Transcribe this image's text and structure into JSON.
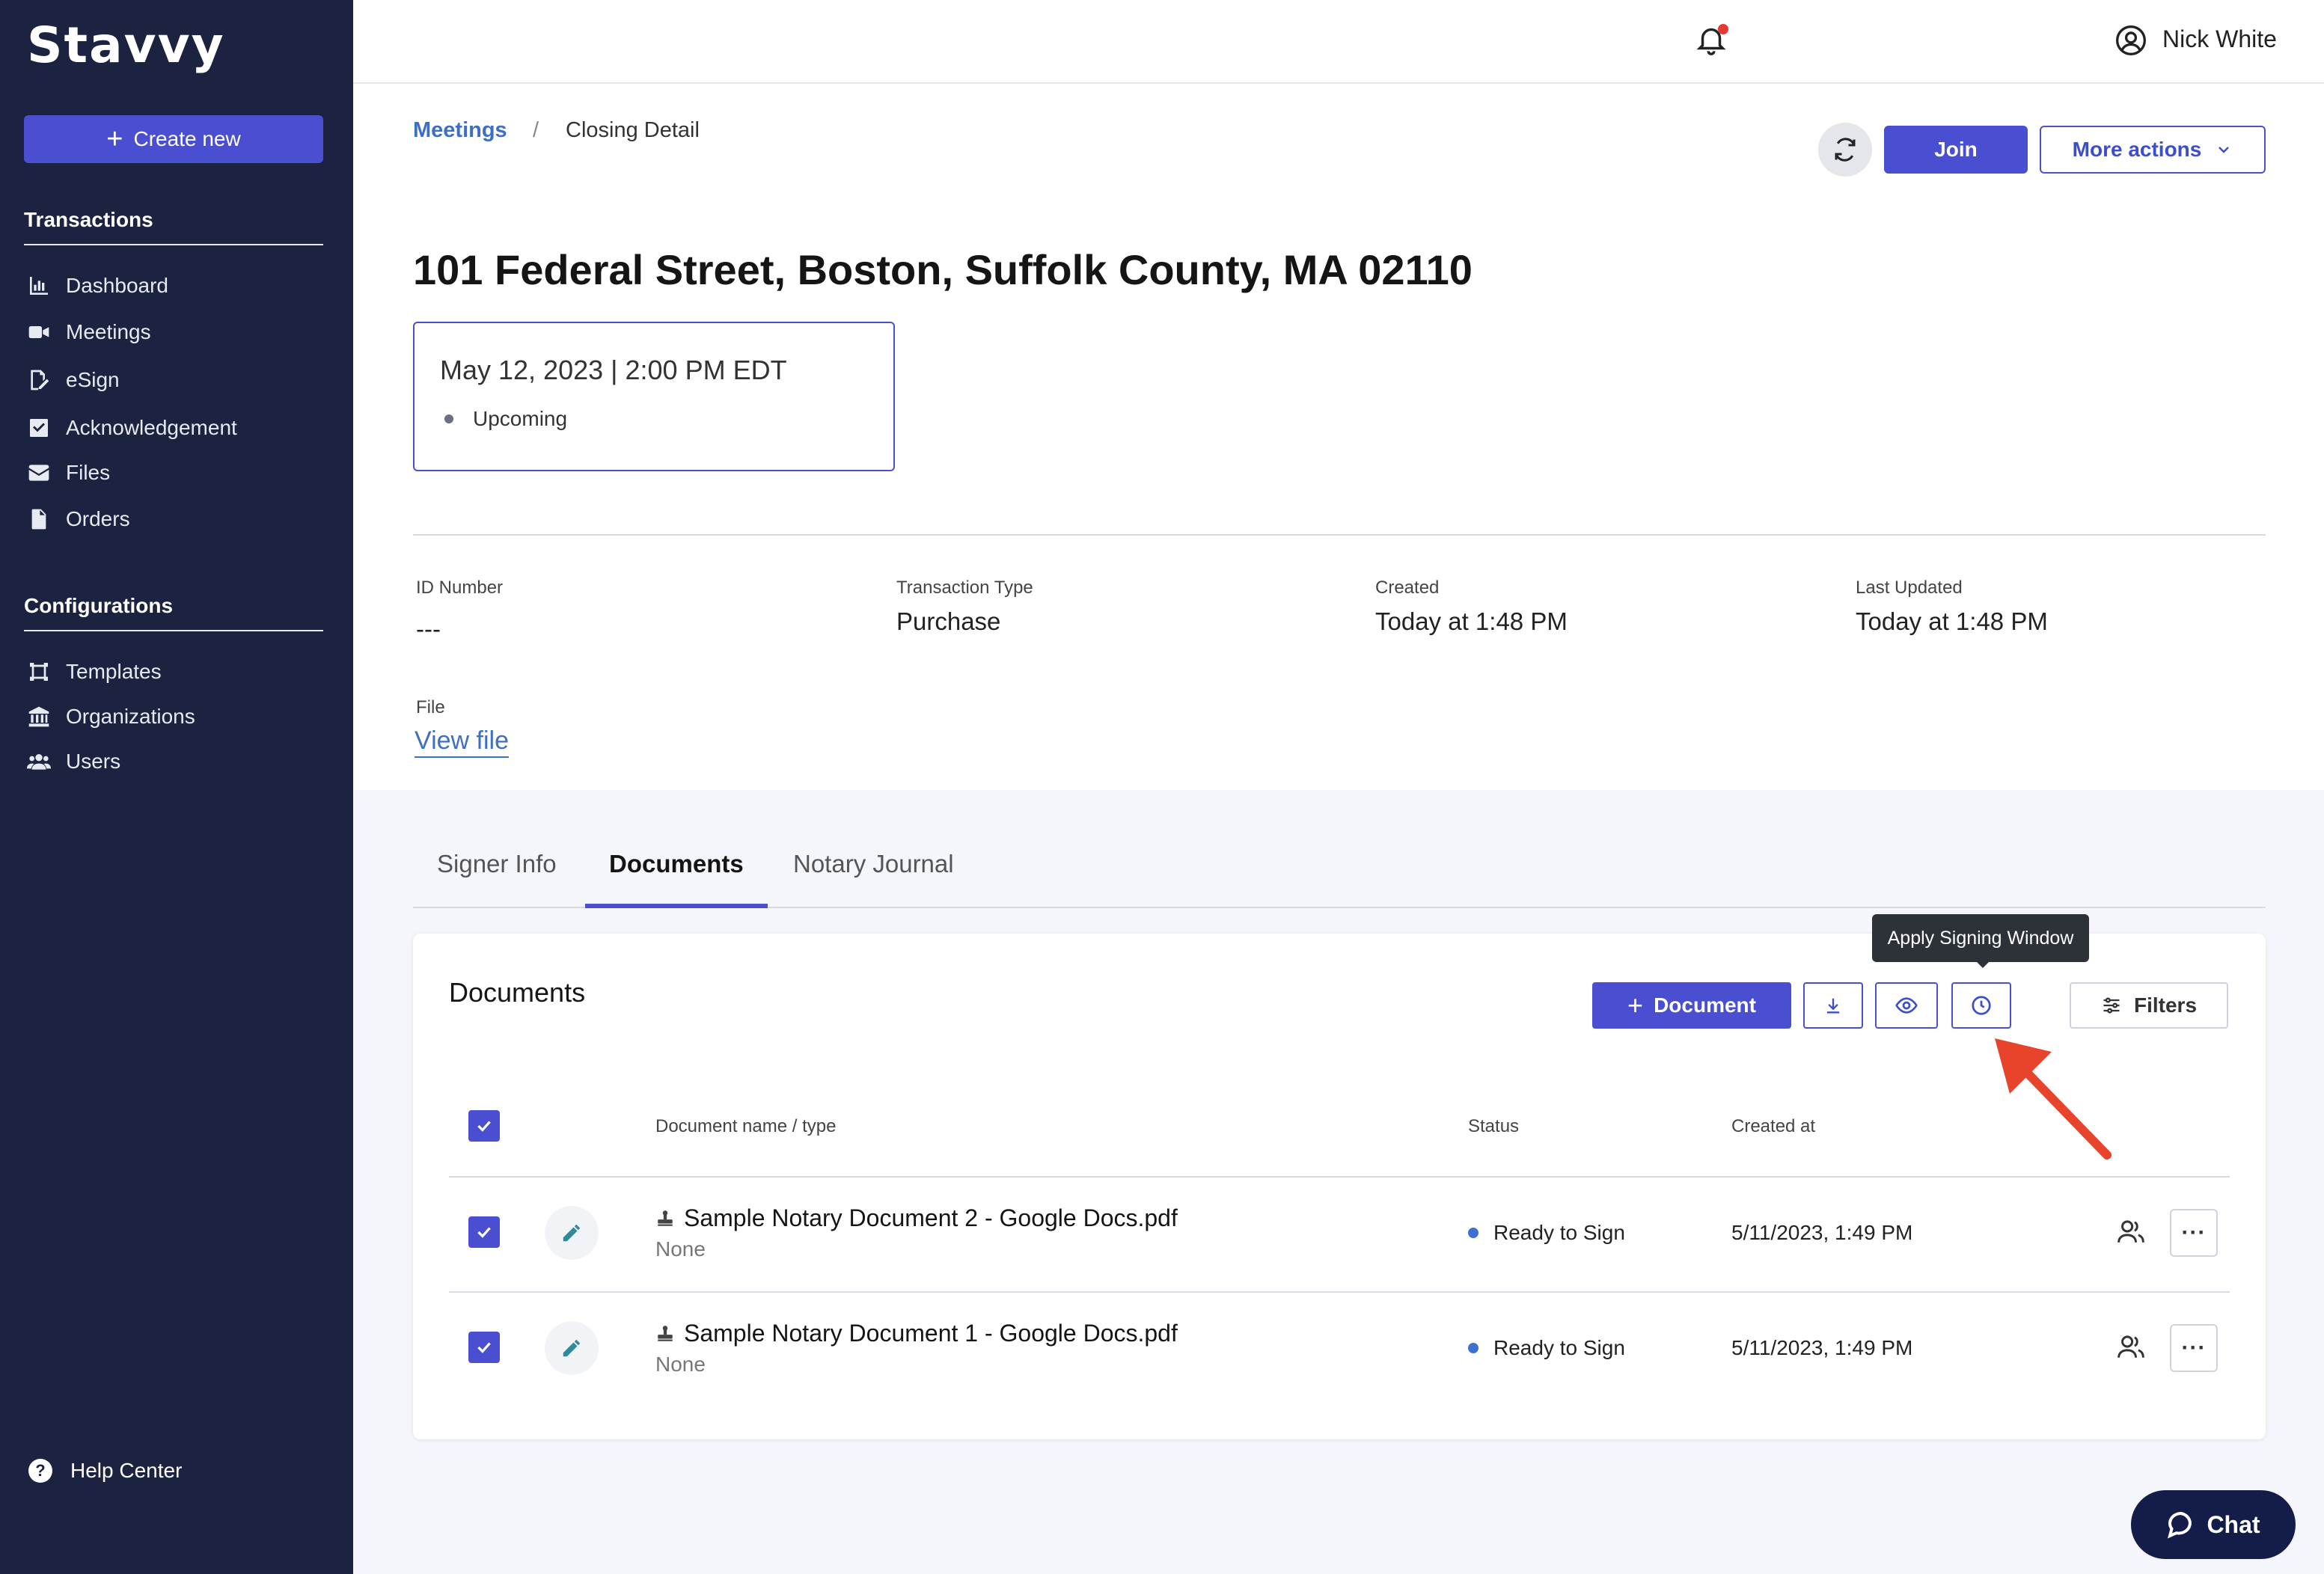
{
  "sidebar": {
    "logo": "Stavvy",
    "create_label": "Create new",
    "sections": [
      {
        "title": "Transactions",
        "items": [
          {
            "label": "Dashboard",
            "icon": "bar-chart-icon"
          },
          {
            "label": "Meetings",
            "icon": "video-icon"
          },
          {
            "label": "eSign",
            "icon": "pen-document-icon"
          },
          {
            "label": "Acknowledgement",
            "icon": "check-square-icon"
          },
          {
            "label": "Files",
            "icon": "envelope-icon"
          },
          {
            "label": "Orders",
            "icon": "file-icon"
          }
        ]
      },
      {
        "title": "Configurations",
        "items": [
          {
            "label": "Templates",
            "icon": "template-icon"
          },
          {
            "label": "Organizations",
            "icon": "bank-icon"
          },
          {
            "label": "Users",
            "icon": "users-icon"
          }
        ]
      }
    ],
    "help_label": "Help Center"
  },
  "topbar": {
    "user_name": "Nick White"
  },
  "breadcrumb": {
    "link": "Meetings",
    "separator": "/",
    "current": "Closing Detail"
  },
  "actions": {
    "join_label": "Join",
    "more_label": "More actions"
  },
  "page_title": "101 Federal Street, Boston, Suffolk County, MA 02110",
  "meeting": {
    "datetime": "May 12, 2023 | 2:00 PM EDT",
    "status": "Upcoming"
  },
  "meta": {
    "id_label": "ID Number",
    "id_value": "---",
    "type_label": "Transaction Type",
    "type_value": "Purchase",
    "created_label": "Created",
    "created_value": "Today at 1:48 PM",
    "updated_label": "Last Updated",
    "updated_value": "Today at 1:48 PM",
    "file_label": "File",
    "file_link": "View file"
  },
  "tabs": [
    {
      "label": "Signer Info",
      "active": false
    },
    {
      "label": "Documents",
      "active": true
    },
    {
      "label": "Notary Journal",
      "active": false
    }
  ],
  "documents": {
    "title": "Documents",
    "add_label": "Document",
    "filters_label": "Filters",
    "tooltip": "Apply Signing Window",
    "columns": {
      "name": "Document name / type",
      "status": "Status",
      "created": "Created at"
    },
    "rows": [
      {
        "name": "Sample Notary Document 2 - Google Docs.pdf",
        "type": "None",
        "status": "Ready to Sign",
        "created": "5/11/2023, 1:49 PM"
      },
      {
        "name": "Sample Notary Document 1 - Google Docs.pdf",
        "type": "None",
        "status": "Ready to Sign",
        "created": "5/11/2023, 1:49 PM"
      }
    ]
  },
  "chat_label": "Chat",
  "colors": {
    "sidebar_bg": "#1c2340",
    "accent": "#4a4fd1",
    "link": "#3d6fc6",
    "status_dot": "#3f6fd0",
    "annotation_arrow": "#e8432b",
    "chat_bg": "#141d4a"
  }
}
